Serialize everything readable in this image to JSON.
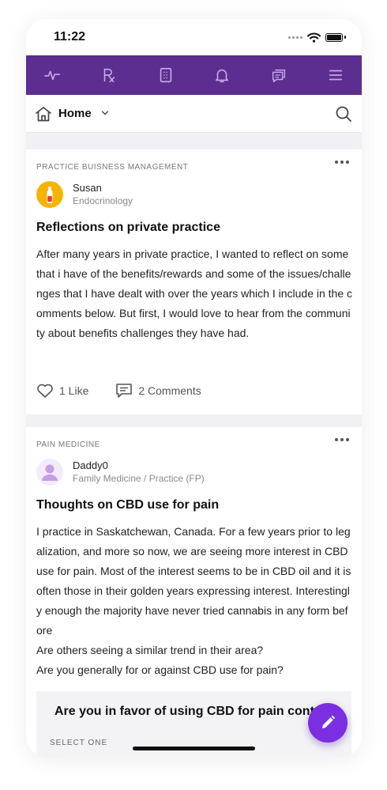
{
  "status": {
    "time": "11:22"
  },
  "nav": {
    "icons": [
      "activity-icon",
      "rx-icon",
      "document-icon",
      "bell-icon",
      "messages-icon",
      "menu-icon"
    ]
  },
  "header": {
    "home_label": "Home"
  },
  "posts": [
    {
      "category": "PRACTICE BUISNESS MANAGEMENT",
      "author": "Susan",
      "specialty": "Endocrinology",
      "title": "Reflections on private practice",
      "body": "After many years in private practice, I wanted to reflect on some that i have of the benefits/rewards and some of the issues/challenges that I have dealt with over the years which I include in the comments below. But first, I would love to hear from the community about benefits challenges they have had.",
      "likes": "1 Like",
      "comments": "2 Comments"
    },
    {
      "category": "PAIN MEDICINE",
      "author": "Daddy0",
      "specialty": "Family Medicine / Practice (FP)",
      "title": "Thoughts on CBD use for pain",
      "body": "I practice in Saskatchewan, Canada.  For a few years prior to legalization, and more so now, we are seeing more interest in CBD use for pain.  Most of the interest seems to be in CBD oil and it is often those in their golden years expressing interest.  Interestingly enough the majority have never tried cannabis in any form before\nAre others seeing a similar trend in their area?\nAre you generally for or against CBD use for pain?",
      "poll_question": "Are you in favor of using CBD for pain control?",
      "poll_hint": "SELECT ONE"
    }
  ],
  "colors": {
    "brand": "#5c2e8f",
    "fab": "#7b2fe0",
    "avatar1": "#f5b400",
    "avatar2": "#e9dcf5"
  }
}
